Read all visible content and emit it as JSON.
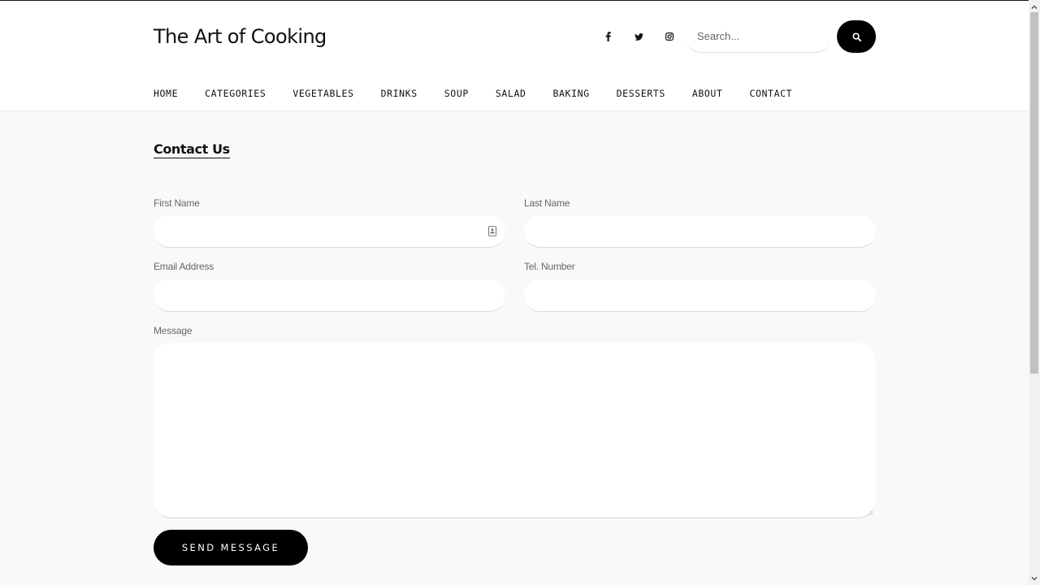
{
  "header": {
    "brand": "The Art of Cooking",
    "social_icons": [
      "facebook-icon",
      "twitter-icon",
      "instagram-icon"
    ],
    "search": {
      "placeholder": "Search..."
    }
  },
  "nav": {
    "items": [
      "HOME",
      "CATEGORIES",
      "VEGETABLES",
      "DRINKS",
      "SOUP",
      "SALAD",
      "BAKING",
      "DESSERTS",
      "ABOUT",
      "CONTACT"
    ]
  },
  "contact": {
    "title": "Contact Us",
    "first_name_label": "First Name",
    "last_name_label": "Last Name",
    "email_label": "Email Address",
    "tel_label": "Tel. Number",
    "message_label": "Message",
    "submit_label": "SEND MESSAGE"
  },
  "colors": {
    "page_bg": "#f8f9fa",
    "header_bg": "#ffffff",
    "button_bg": "#000000",
    "label_text": "#666666"
  }
}
